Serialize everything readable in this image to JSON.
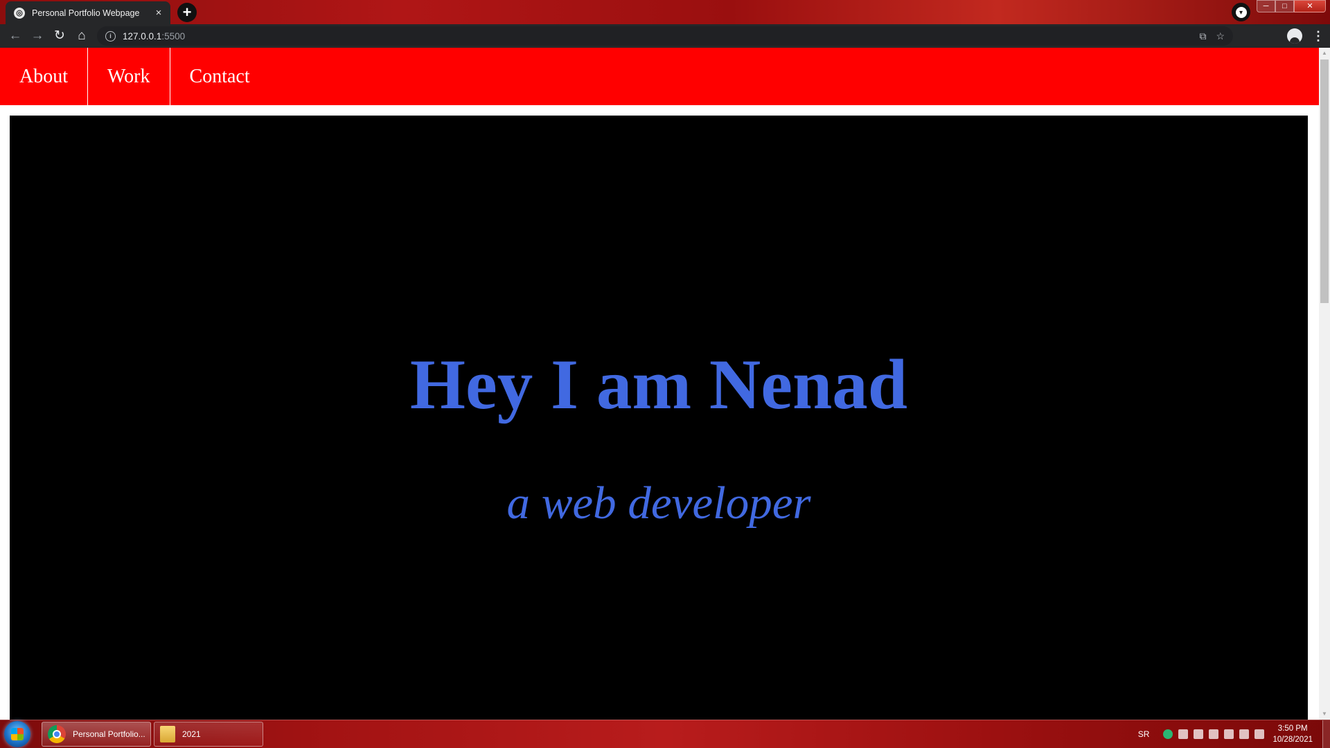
{
  "browser": {
    "tab_title": "Personal Portfolio Webpage",
    "tab_close": "×",
    "new_tab": "+",
    "url_host": "127.0.0.1",
    "url_port": ":5500",
    "back": "←",
    "forward": "→",
    "reload": "↻",
    "home": "⌂",
    "star": "☆",
    "translate": "⧉",
    "menu": "⋮",
    "profile_down": "▾"
  },
  "window": {
    "minimize": "─",
    "maximize": "□",
    "close": "✕"
  },
  "site": {
    "nav": [
      "About",
      "Work",
      "Contact"
    ],
    "heading": "Hey I am Nenad",
    "subheading": "a web developer"
  },
  "taskbar": {
    "items": [
      {
        "label": "Personal Portfolio..."
      },
      {
        "label": "2021"
      }
    ],
    "language": "SR",
    "time": "3:50 PM",
    "date": "10/28/2021"
  },
  "colors": {
    "nav_bg": "#ff0000",
    "hero_bg": "#000000",
    "heading": "#4169e1"
  }
}
